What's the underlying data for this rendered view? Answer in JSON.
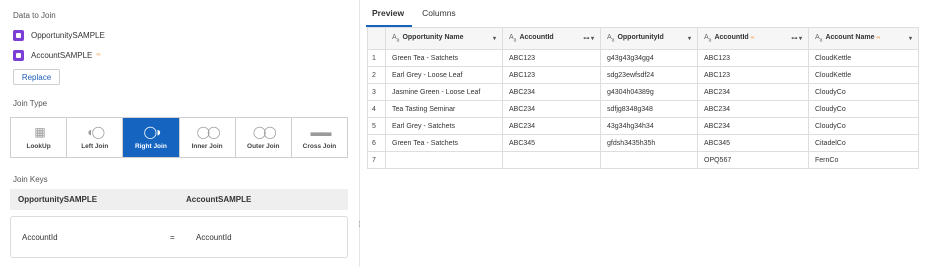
{
  "left": {
    "data_to_join_label": "Data to Join",
    "datasources": [
      {
        "name": "OpportunitySAMPLE",
        "mark": ""
      },
      {
        "name": "AccountSAMPLE",
        "mark": "∞"
      }
    ],
    "replace_label": "Replace",
    "join_type_label": "Join Type",
    "join_types": [
      {
        "label": "LookUp",
        "glyph": "▦",
        "active": false
      },
      {
        "label": "Left Join",
        "glyph": "◐◯",
        "active": false
      },
      {
        "label": "Right Join",
        "glyph": "◯◑",
        "active": true
      },
      {
        "label": "Inner Join",
        "glyph": "◯◯",
        "active": false
      },
      {
        "label": "Outer Join",
        "glyph": "◯◯",
        "active": false
      },
      {
        "label": "Cross Join",
        "glyph": "▬▬",
        "active": false
      }
    ],
    "join_keys_label": "Join Keys",
    "join_keys": {
      "left_source": "OpportunitySAMPLE",
      "right_source": "AccountSAMPLE",
      "left_key": "AccountId",
      "operator": "=",
      "right_key": "AccountId"
    }
  },
  "right": {
    "tabs": [
      "Preview",
      "Columns"
    ],
    "active_tab": "Preview",
    "columns": [
      {
        "name": "Opportunity Name",
        "type": "A",
        "icons": "▾",
        "linked": false
      },
      {
        "name": "AccountId",
        "type": "A",
        "icons": "⊶ ▾",
        "linked": false
      },
      {
        "name": "OpportunityId",
        "type": "A",
        "icons": "▾",
        "linked": false
      },
      {
        "name": "AccountId",
        "type": "A",
        "icons": "⊶ ▾",
        "linked": true
      },
      {
        "name": "Account Name",
        "type": "A",
        "icons": "▾",
        "linked": true
      }
    ],
    "rows": [
      [
        "1",
        "Green Tea - Satchets",
        "ABC123",
        "g43g43g34gg4",
        "ABC123",
        "CloudKettle"
      ],
      [
        "2",
        "Earl Grey - Loose Leaf",
        "ABC123",
        "sdg23ewfsdf24",
        "ABC123",
        "CloudKettle"
      ],
      [
        "3",
        "Jasmine Green - Loose Leaf",
        "ABC234",
        "g4304h04389g",
        "ABC234",
        "CloudyCo"
      ],
      [
        "4",
        "Tea Tasting Seminar",
        "ABC234",
        "sdfjg8348g348",
        "ABC234",
        "CloudyCo"
      ],
      [
        "5",
        "Earl Grey - Satchets",
        "ABC234",
        "43g34hg34h34",
        "ABC234",
        "CloudyCo"
      ],
      [
        "6",
        "Green Tea - Satchets",
        "ABC345",
        "gfdsh3435h35h",
        "ABC345",
        "CitadelCo"
      ],
      [
        "7",
        "",
        "",
        "",
        "OPQ567",
        "FernCo"
      ]
    ]
  },
  "colors": {
    "accent": "#1565c0",
    "datasource_icon": "#7b3fd6",
    "link_mark": "#f0a24b"
  }
}
